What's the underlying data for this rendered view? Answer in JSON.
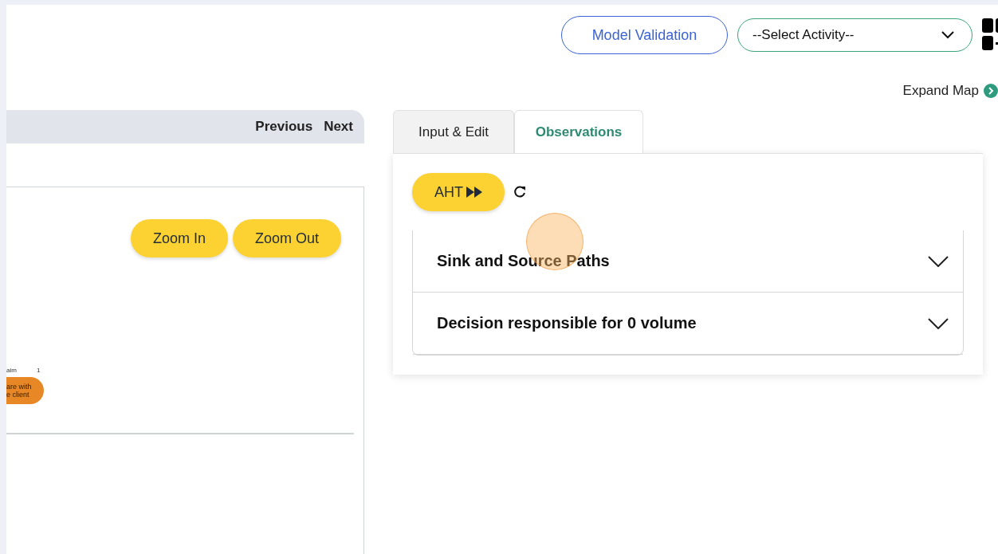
{
  "header": {
    "validation_button": "Model Validation",
    "activity_select": {
      "value": "--Select Activity--"
    }
  },
  "expand_map": {
    "label": "Expand Map"
  },
  "map": {
    "nav": [
      "Previous",
      "Next"
    ],
    "zoom_buttons": [
      "Zoom In",
      "Zoom Out"
    ],
    "node": {
      "caption": "aim",
      "count": "1",
      "lines": [
        "are with",
        "e client"
      ]
    }
  },
  "tabs": [
    {
      "label": "Input & Edit",
      "selected": false
    },
    {
      "label": "Observations",
      "selected": true
    }
  ],
  "observations": {
    "aht_button": "AHT",
    "sections": [
      {
        "title": "Sink and Source Paths",
        "expanded": false
      },
      {
        "title": "Decision responsible for 0 volume",
        "expanded": false
      }
    ]
  }
}
